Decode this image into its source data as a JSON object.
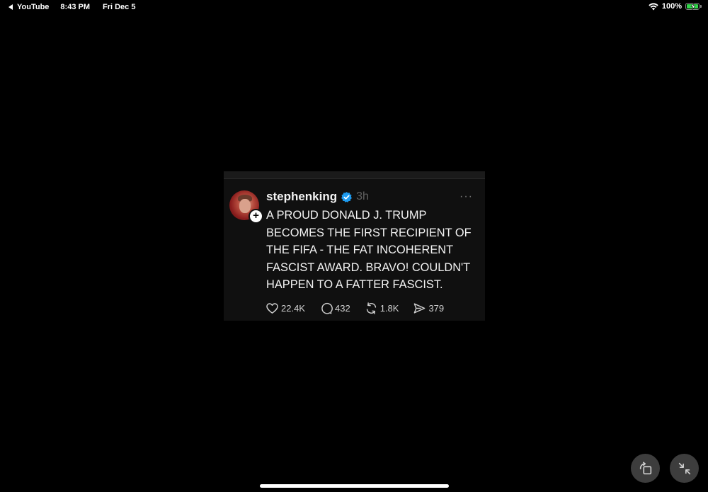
{
  "status_bar": {
    "back_app": "YouTube",
    "time": "8:43 PM",
    "date": "Fri Dec 5",
    "battery": "100%",
    "battery_level": 1.0
  },
  "post": {
    "username": "stephenking",
    "verified": true,
    "time_ago": "3h",
    "more_label": "···",
    "text": "A PROUD DONALD J. TRUMP BECOMES THE FIRST RECIPIENT OF THE FIFA - THE FAT INCOHERENT FASCIST AWARD. BRAVO! COULDN'T HAPPEN TO A FATTER FASCIST.",
    "likes": "22.4K",
    "replies": "432",
    "reposts": "1.8K",
    "shares": "379"
  },
  "icons": {
    "back": "back-arrow-icon",
    "wifi": "wifi-icon",
    "battery": "battery-charging-icon",
    "verified": "verified-badge-icon",
    "like": "heart-icon",
    "reply": "comment-icon",
    "repost": "repost-icon",
    "share": "send-icon",
    "rotate": "rotate-icon",
    "collapse": "collapse-icon"
  },
  "colors": {
    "background": "#000000",
    "card": "#101010",
    "verified": "#1d9bf0",
    "battery": "#32d74b"
  }
}
